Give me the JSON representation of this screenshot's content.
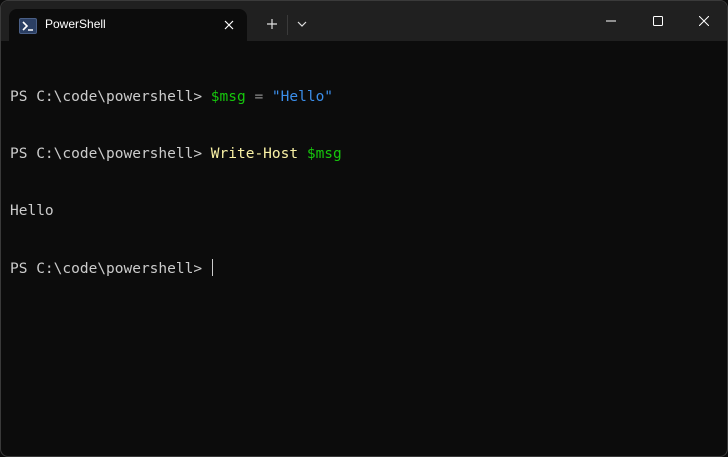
{
  "tab": {
    "title": "PowerShell",
    "icon": "powershell-icon"
  },
  "controls": {
    "new_tab_icon": "plus-icon",
    "dropdown_icon": "chevron-down-icon",
    "minimize_icon": "minimize-icon",
    "maximize_icon": "maximize-icon",
    "close_icon": "close-icon"
  },
  "terminal": {
    "line1": {
      "prompt": "PS C:\\code\\powershell> ",
      "var": "$msg",
      "op": " = ",
      "str": "\"Hello\""
    },
    "line2": {
      "prompt": "PS C:\\code\\powershell> ",
      "cmd": "Write-Host",
      "sp": " ",
      "var": "$msg"
    },
    "line3": {
      "output": "Hello"
    },
    "line4": {
      "prompt": "PS C:\\code\\powershell> "
    }
  },
  "colors": {
    "background": "#0c0c0c",
    "titlebar": "#202020",
    "text": "#cccccc",
    "variable": "#16c60c",
    "string": "#3b8eea",
    "command": "#f9f1a5"
  }
}
